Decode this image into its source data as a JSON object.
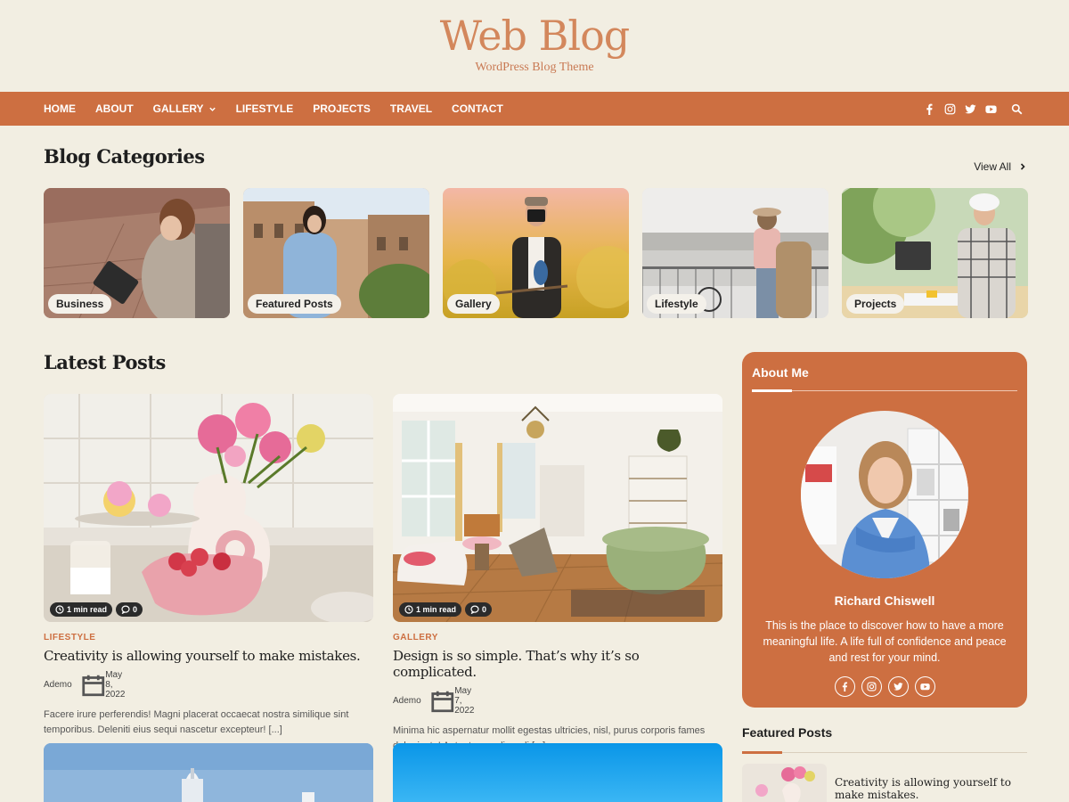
{
  "site": {
    "title": "Web Blog",
    "tagline": "WordPress Blog Theme"
  },
  "nav": {
    "items": [
      "HOME",
      "ABOUT",
      "GALLERY",
      "LIFESTYLE",
      "PROJECTS",
      "TRAVEL",
      "CONTACT"
    ],
    "social_icons": [
      "facebook-icon",
      "instagram-icon",
      "twitter-icon",
      "youtube-icon",
      "search-icon"
    ]
  },
  "categories_section": {
    "title": "Blog Categories",
    "view_all": "View All",
    "items": [
      {
        "label": "Business"
      },
      {
        "label": "Featured Posts"
      },
      {
        "label": "Gallery"
      },
      {
        "label": "Lifestyle"
      },
      {
        "label": "Projects"
      }
    ]
  },
  "latest_posts": {
    "title": "Latest Posts",
    "posts": [
      {
        "read_time": "1 min read",
        "comments": "0",
        "category": "LIFESTYLE",
        "title": "Creativity is allowing yourself to make mistakes.",
        "author": "Ademo",
        "date": "May 8, 2022",
        "excerpt": "Facere irure perferendis! Magni placerat occaecat nostra similique sint temporibus. Deleniti eius sequi nascetur excepteur! [...]"
      },
      {
        "read_time": "1 min read",
        "comments": "0",
        "category": "GALLERY",
        "title": "Design is so simple. That’s why it’s so complicated.",
        "author": "Ademo",
        "date": "May 7, 2022",
        "excerpt": "Minima hic aspernatur mollit egestas ultricies, nisl, purus corporis fames dolor justo! Aptent, eos eligendi [...]"
      }
    ]
  },
  "about": {
    "heading": "About Me",
    "name": "Richard Chiswell",
    "text": "This is the place to discover how to have a more meaningful life. A life full of confidence and peace and rest for your mind."
  },
  "featured": {
    "heading": "Featured Posts",
    "first_title": "Creativity is allowing yourself to make mistakes."
  },
  "colors": {
    "accent": "#cd6f41",
    "background": "#f2eee2",
    "title": "#d3875c"
  }
}
